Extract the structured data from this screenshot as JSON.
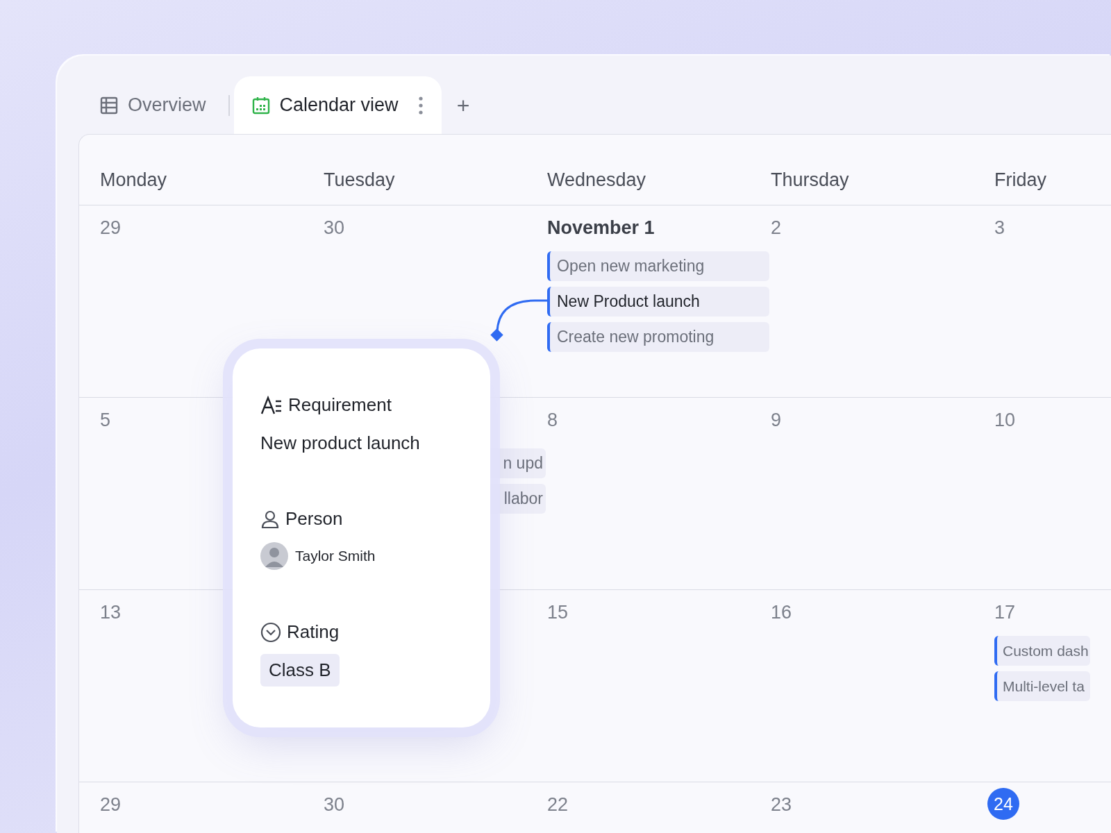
{
  "tabs": [
    {
      "label": "Overview",
      "selected": false
    },
    {
      "label": "Calendar view",
      "selected": true
    }
  ],
  "add_tab": "+",
  "calendar": {
    "weekdays": [
      "Monday",
      "Tuesday",
      "Wednesday",
      "Thursday",
      "Friday"
    ],
    "weeks": [
      {
        "days": [
          {
            "date": "29"
          },
          {
            "date": "30"
          },
          {
            "date": "November 1",
            "emphasized": true,
            "events": [
              {
                "title": "Open new marketing",
                "selected": false
              },
              {
                "title": "New Product launch",
                "selected": true
              },
              {
                "title": "Create new promoting",
                "selected": false
              }
            ]
          },
          {
            "date": "2"
          },
          {
            "date": "3"
          }
        ]
      },
      {
        "days": [
          {
            "date": "5"
          },
          {
            "events": [
              {
                "title": "n upd",
                "selected": false
              },
              {
                "title": "llabor",
                "selected": false
              }
            ]
          },
          {
            "date": "8"
          },
          {
            "date": "9"
          },
          {
            "date": "10"
          }
        ]
      },
      {
        "days": [
          {
            "date": "13"
          },
          {
            "date": "15"
          },
          {
            "date": "16"
          },
          {
            "date": "17",
            "events": [
              {
                "title": "Custom dash",
                "selected": false
              },
              {
                "title": "Multi-level ta",
                "selected": false
              }
            ]
          }
        ]
      },
      {
        "days": [
          {
            "date": "29"
          },
          {
            "date": "30"
          },
          {
            "date": "22"
          },
          {
            "date": "23"
          },
          {
            "date": "24",
            "today": true
          }
        ]
      }
    ]
  },
  "popup": {
    "fields": [
      {
        "kind": "text",
        "label": "Requirement",
        "value": "New product launch"
      },
      {
        "kind": "person",
        "label": "Person",
        "value": "Taylor Smith"
      },
      {
        "kind": "option",
        "label": "Rating",
        "value": "Class B"
      }
    ]
  }
}
